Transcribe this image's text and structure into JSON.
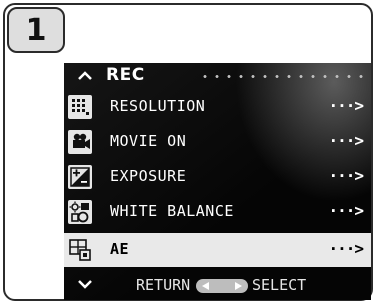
{
  "step": "1",
  "menu": {
    "title": "REC",
    "items": [
      {
        "label": "RESOLUTION",
        "more": "···>",
        "icon": "resolution-icon"
      },
      {
        "label": "MOVIE ON",
        "more": "···>",
        "icon": "movie-camera-icon"
      },
      {
        "label": "EXPOSURE",
        "more": "···>",
        "icon": "exposure-compensation-icon"
      },
      {
        "label": "WHITE BALANCE",
        "more": "···>",
        "icon": "white-balance-icon"
      },
      {
        "label": "AE",
        "more": "···>",
        "icon": "ae-metering-icon",
        "selected": true
      }
    ]
  },
  "footer": {
    "return_label": "RETURN",
    "select_label": "SELECT"
  },
  "colors": {
    "screen_bg": "#050505",
    "selected_bg": "#e9e9e9",
    "text": "#ffffff"
  }
}
